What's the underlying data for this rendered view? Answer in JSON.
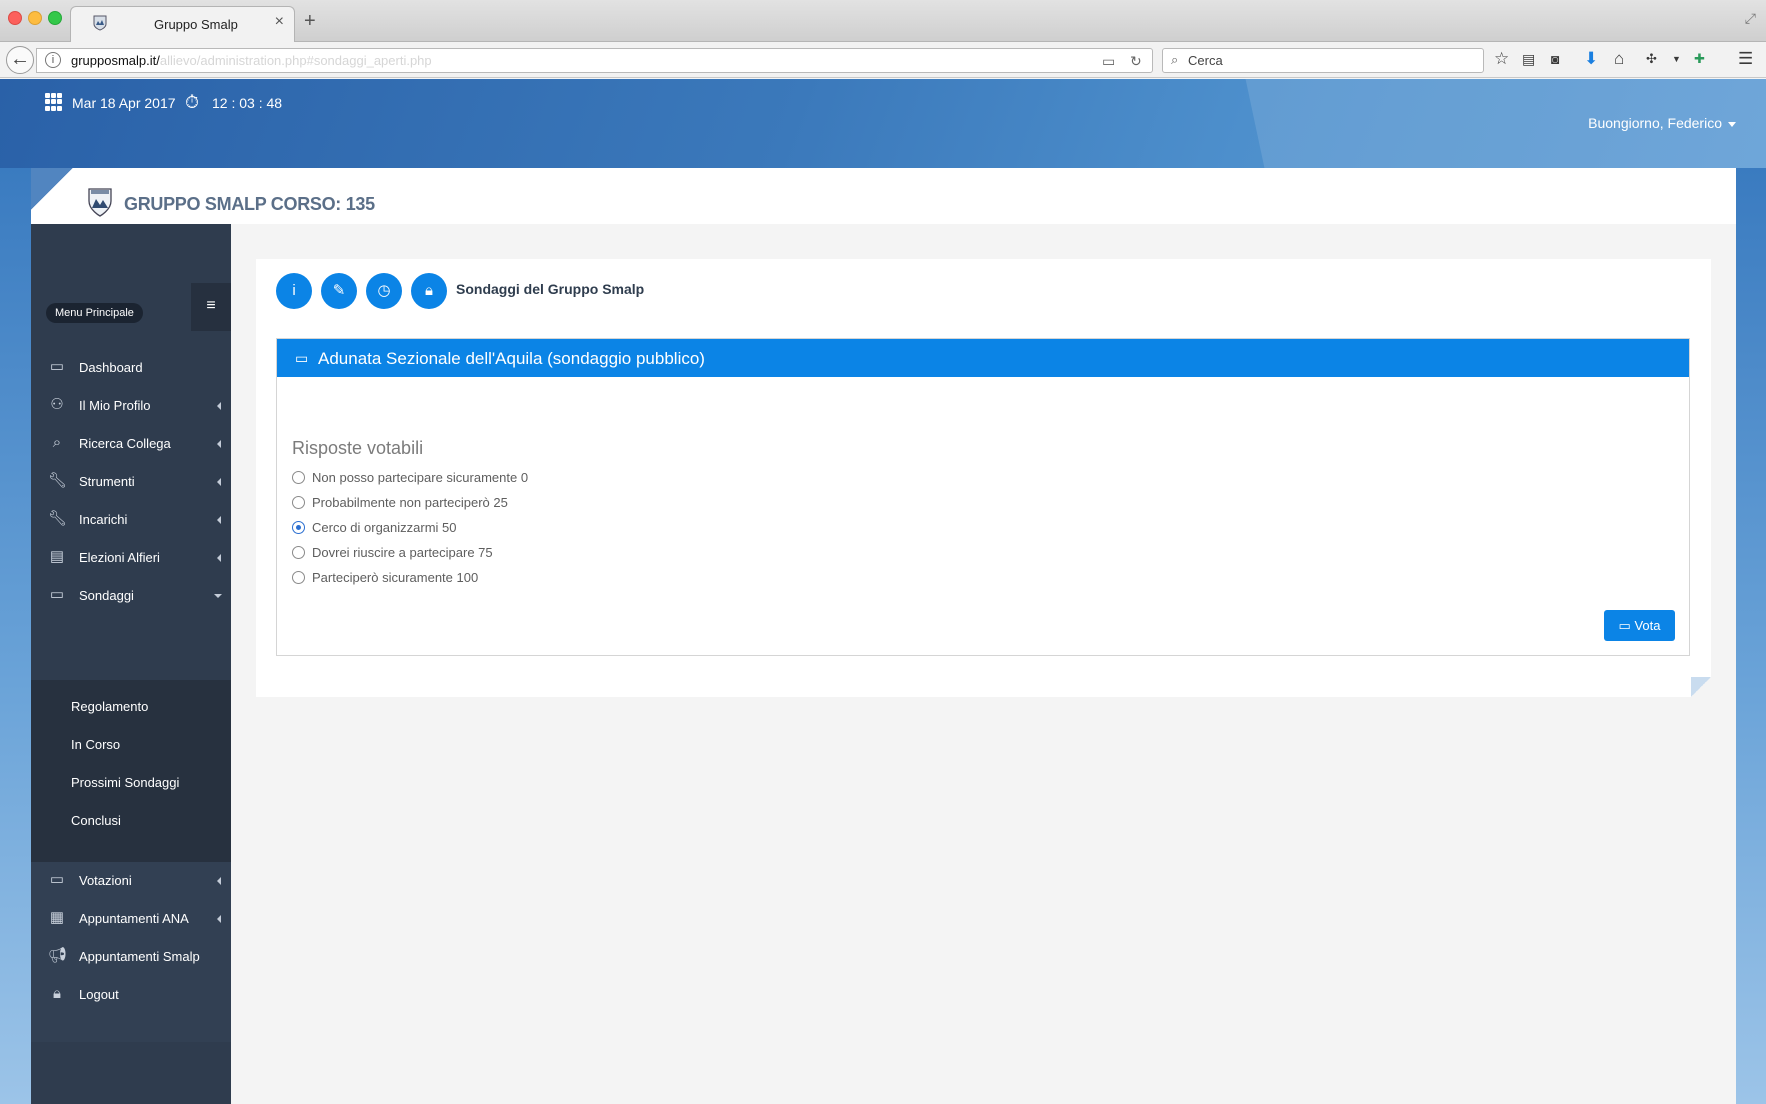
{
  "browser": {
    "tab_title": "Gruppo Smalp",
    "tab_close": "×",
    "new_tab": "+",
    "url_host": "grupposmalp.it/",
    "url_path": "allievo/administration.php#sondaggi_aperti.php",
    "search_placeholder": "Cerca",
    "icons": [
      "back-icon",
      "info-icon",
      "reader-icon",
      "reload-icon",
      "search-icon",
      "bookmark-star-icon",
      "library-icon",
      "pocket-icon",
      "download-icon",
      "home-icon",
      "extension-icon",
      "menu-icon"
    ]
  },
  "header": {
    "date": "Mar 18 Apr 2017",
    "time": "12 : 03 : 48",
    "greeting": "Buongiorno, Federico"
  },
  "brand": {
    "title": "GRUPPO SMALP CORSO: 135"
  },
  "sidebar": {
    "menu_label": "Menu Principale",
    "items": [
      {
        "label": "Dashboard",
        "icon": "monitor-icon"
      },
      {
        "label": "Il Mio Profilo",
        "icon": "user-icon"
      },
      {
        "label": "Ricerca Collega",
        "icon": "search-icon"
      },
      {
        "label": "Strumenti",
        "icon": "wrench-icon"
      },
      {
        "label": "Incarichi",
        "icon": "wrench-icon"
      },
      {
        "label": "Elezioni Alfieri",
        "icon": "id-card-icon"
      },
      {
        "label": "Sondaggi",
        "icon": "comment-icon"
      },
      {
        "label": "Votazioni",
        "icon": "comments-icon"
      },
      {
        "label": "Appuntamenti ANA",
        "icon": "calendar-icon"
      },
      {
        "label": "Appuntamenti Smalp",
        "icon": "megaphone-icon"
      },
      {
        "label": "Logout",
        "icon": "lock-icon"
      }
    ],
    "sondaggi_sub": [
      "Regolamento",
      "In Corso",
      "Prossimi Sondaggi",
      "Conclusi"
    ]
  },
  "main": {
    "title": "Sondaggi del Gruppo Smalp",
    "action_icons": [
      "info-icon",
      "pencil-icon",
      "clock-icon",
      "lock-icon"
    ],
    "panel": {
      "title": "Adunata Sezionale dell'Aquila (sondaggio pubblico)",
      "section_title": "Risposte votabili",
      "options": [
        {
          "label": "Non posso partecipare sicuramente 0",
          "selected": false
        },
        {
          "label": "Probabilmente non parteciperò 25",
          "selected": false
        },
        {
          "label": "Cerco di organizzarmi 50",
          "selected": true
        },
        {
          "label": "Dovrei riuscire a partecipare 75",
          "selected": false
        },
        {
          "label": "Parteciperò sicuramente 100",
          "selected": false
        }
      ],
      "vote_label": "Vota"
    }
  },
  "colors": {
    "primary": "#0b84e6",
    "sidebar": "#2f3c4e",
    "header_blue": "#3b79bb"
  }
}
